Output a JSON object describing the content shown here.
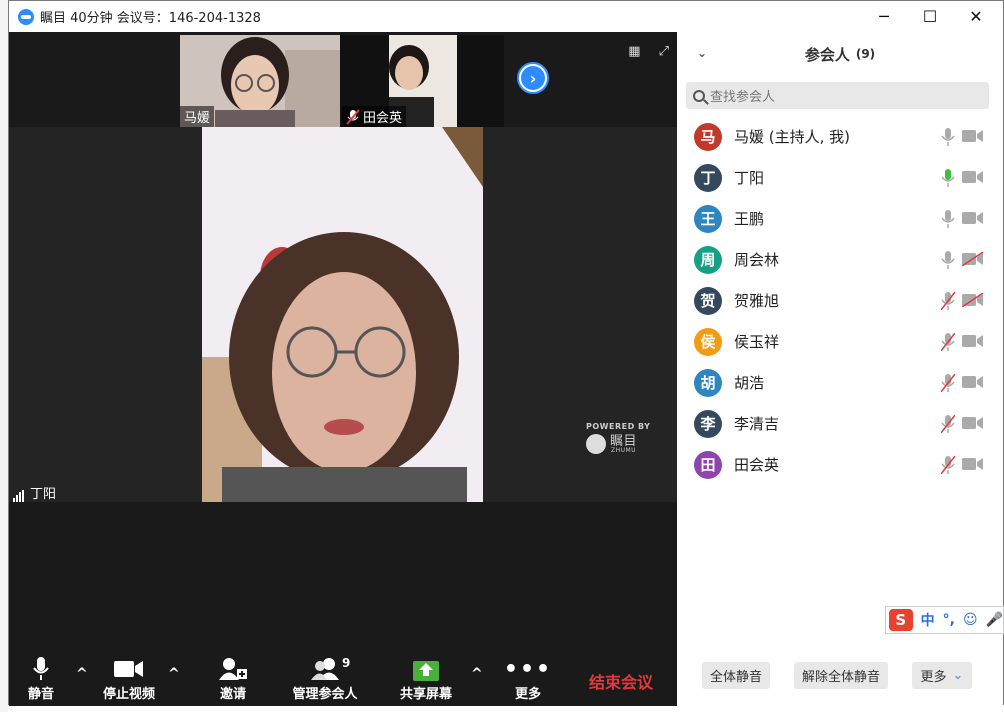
{
  "window": {
    "title": "瞩目 40分钟 会议号：146-204-1328",
    "minimize": "─",
    "maximize": "☐",
    "close": "✕"
  },
  "thumbnails": [
    {
      "name": "马媛",
      "muted": false
    },
    {
      "name": "田会英",
      "muted": true
    }
  ],
  "video": {
    "active_speaker": "丁阳",
    "powered_by": "POWERED BY",
    "brand": "瞩目",
    "brand_sub": "ZHUMU"
  },
  "toolbar": {
    "mute": "静音",
    "stop_video": "停止视频",
    "invite": "邀请",
    "manage": "管理参会人",
    "manage_count": "9",
    "share": "共享屏幕",
    "more": "更多",
    "end": "结束会议"
  },
  "panel": {
    "title": "参会人",
    "count": "(9)",
    "search_placeholder": "查找参会人",
    "participants": [
      {
        "avatar": "马",
        "name": "马媛 (主持人, 我)",
        "color": "#c0392b",
        "mic": "on",
        "video": "on"
      },
      {
        "avatar": "丁",
        "name": "丁阳",
        "color": "#34495e",
        "mic": "speaking",
        "video": "on"
      },
      {
        "avatar": "王",
        "name": "王鹏",
        "color": "#2e86c1",
        "mic": "on",
        "video": "on"
      },
      {
        "avatar": "周",
        "name": "周会林",
        "color": "#16a085",
        "mic": "on",
        "video": "off"
      },
      {
        "avatar": "贺",
        "name": "贺雅旭",
        "color": "#34495e",
        "mic": "off",
        "video": "off"
      },
      {
        "avatar": "侯",
        "name": "侯玉祥",
        "color": "#f39c12",
        "mic": "off",
        "video": "on"
      },
      {
        "avatar": "胡",
        "name": "胡浩",
        "color": "#2e86c1",
        "mic": "off",
        "video": "on"
      },
      {
        "avatar": "李",
        "name": "李清吉",
        "color": "#34495e",
        "mic": "off",
        "video": "on"
      },
      {
        "avatar": "田",
        "name": "田会英",
        "color": "#8e44ad",
        "mic": "off",
        "video": "on"
      }
    ],
    "mute_all": "全体静音",
    "unmute_all": "解除全体静音",
    "more": "更多"
  },
  "ime": {
    "logo": "S",
    "mode": "中",
    "punct": "°,"
  }
}
